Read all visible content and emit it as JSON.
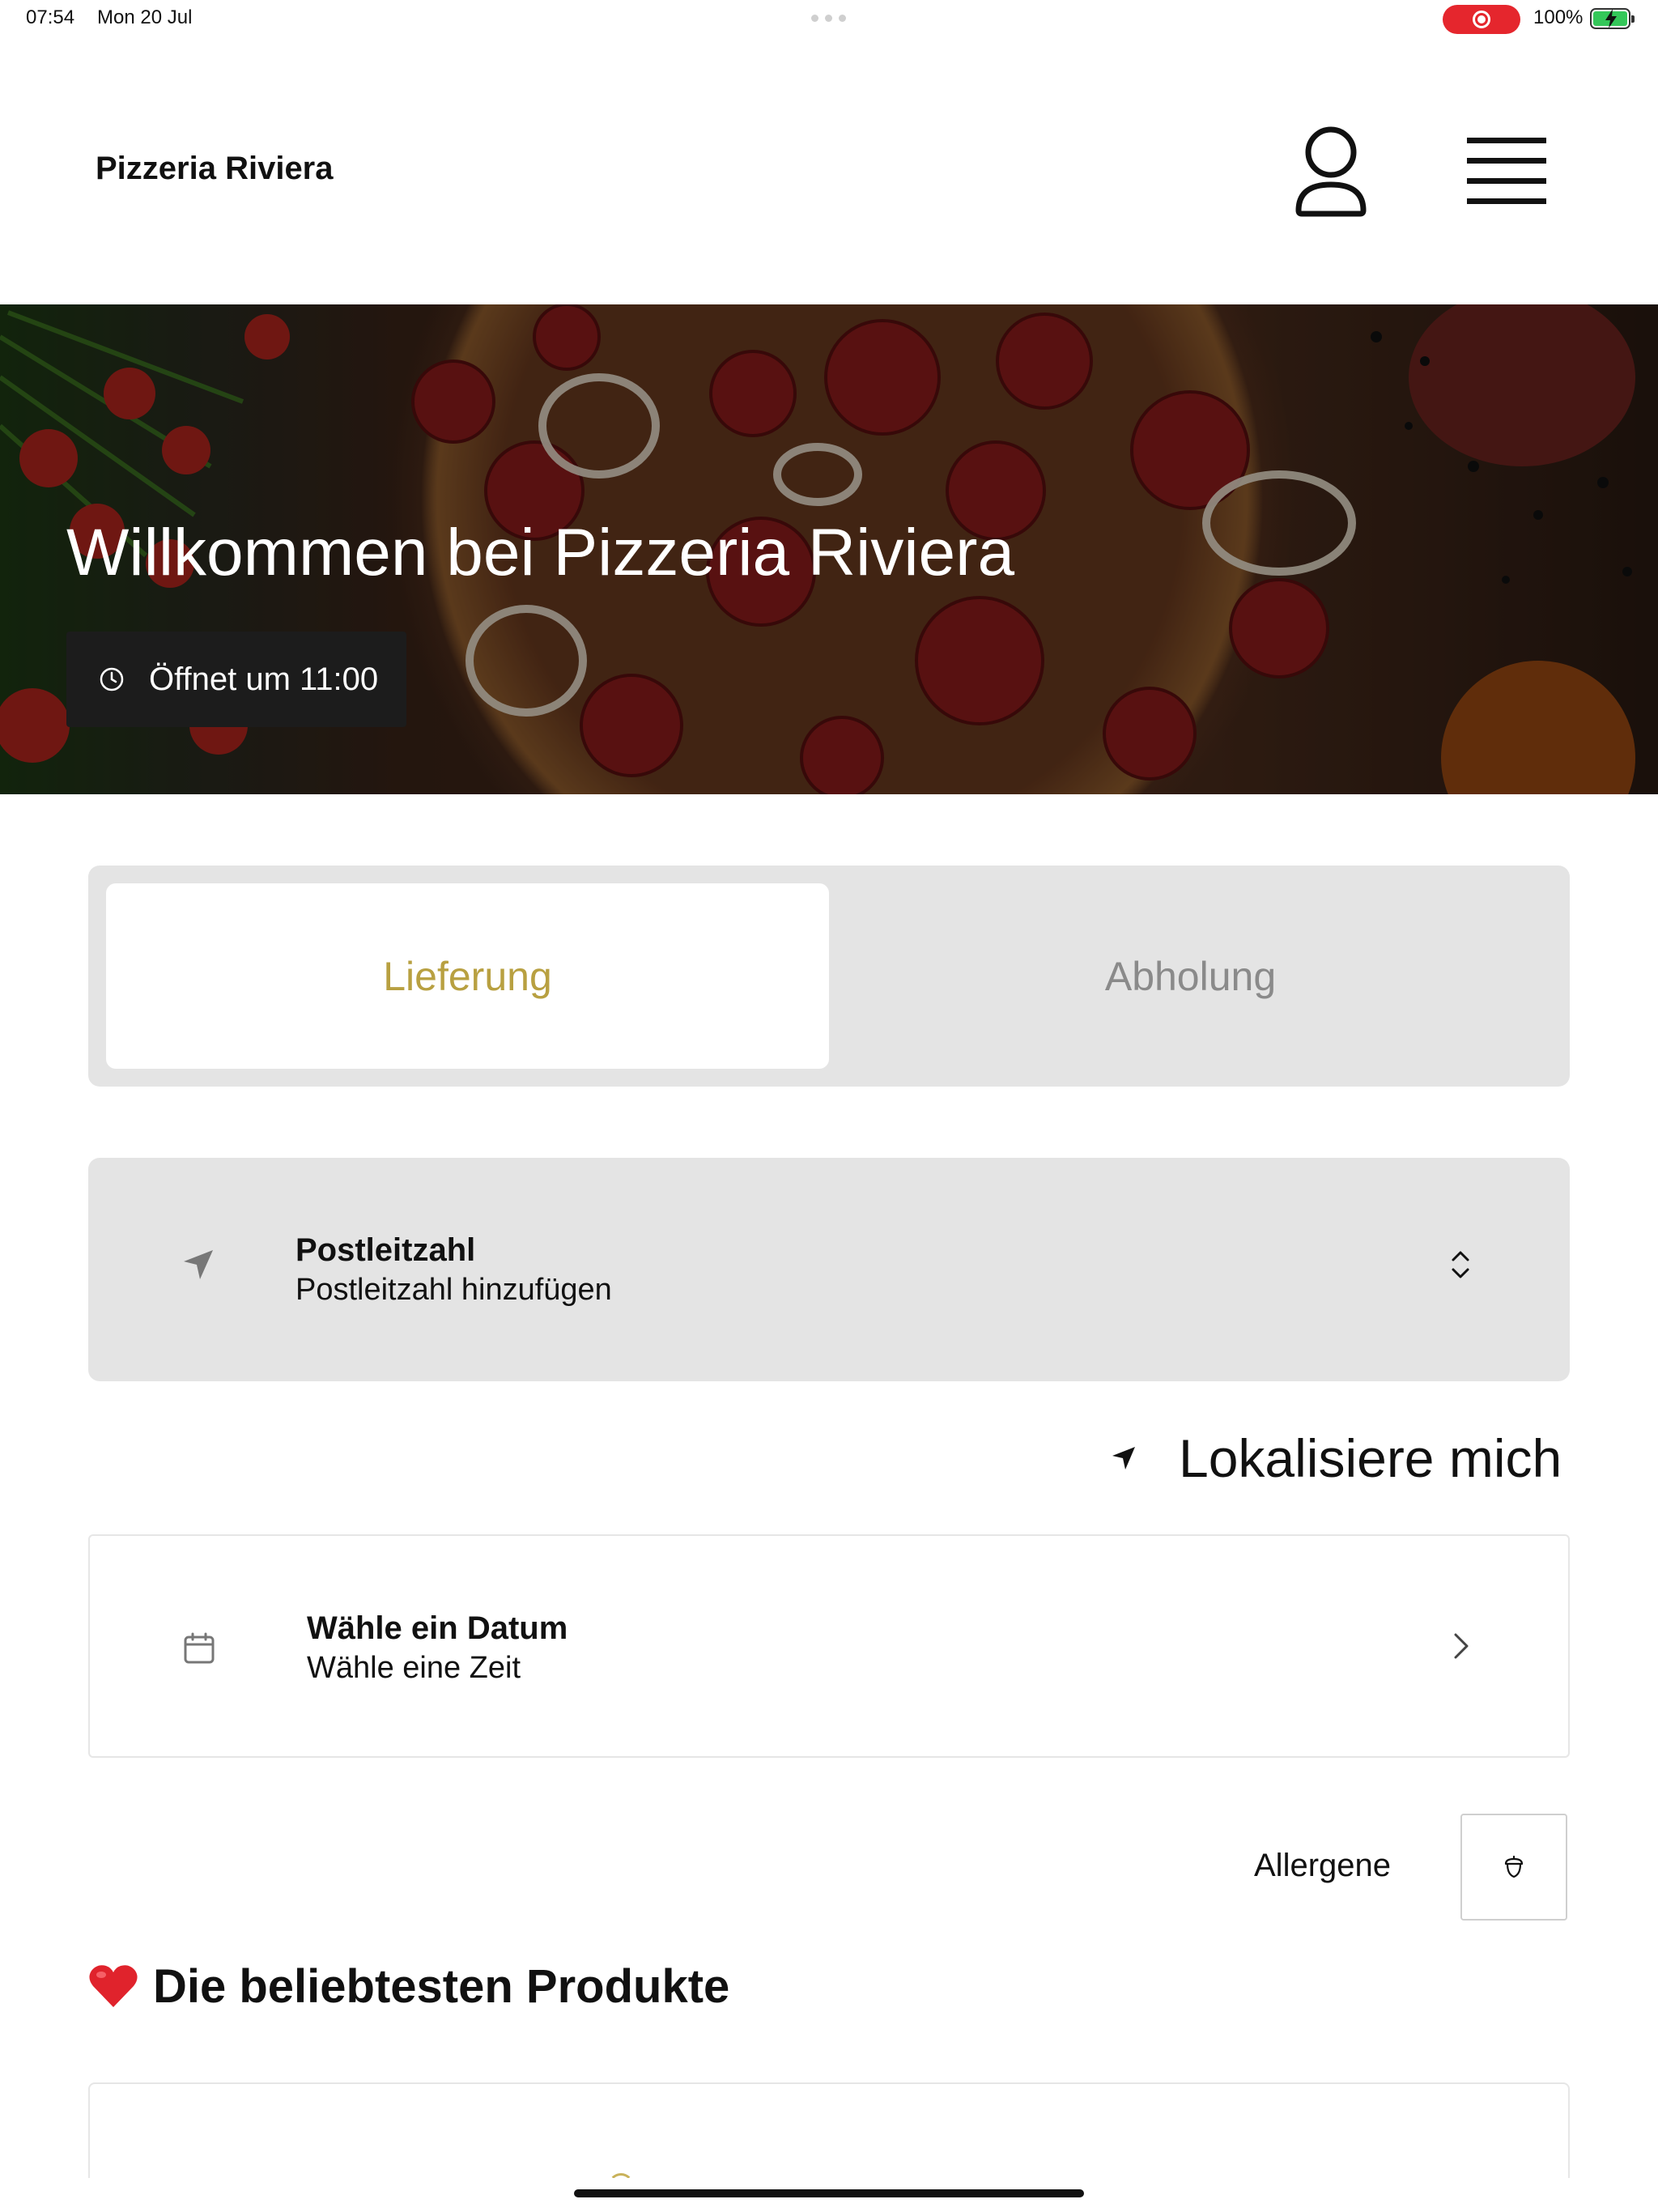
{
  "status_bar": {
    "time": "07:54",
    "date": "Mon 20 Jul",
    "battery": "100%",
    "record_color": "#e5262d"
  },
  "header": {
    "title": "Pizzeria Riviera",
    "profile_icon": "person-icon",
    "menu_icon": "hamburger-menu-icon"
  },
  "hero": {
    "title": "Willkommen bei Pizzeria Riviera",
    "hours": "Öffnet um 11:00",
    "hours_icon": "clock-icon"
  },
  "order_type": {
    "tabs": [
      {
        "label": "Lieferung",
        "active": true
      },
      {
        "label": "Abholung",
        "active": false
      }
    ],
    "accent_color": "#b8a041"
  },
  "postcode": {
    "label": "Postleitzahl",
    "value": "Postleitzahl hinzufügen",
    "icon": "location-arrow-icon"
  },
  "locate": {
    "label": "Lokalisiere mich",
    "icon": "location-arrow-icon"
  },
  "schedule": {
    "label": "Wähle ein Datum",
    "value": "Wähle eine Zeit",
    "icon": "calendar-icon"
  },
  "allergens": {
    "label": "Allergene",
    "icon": "acorn-icon"
  },
  "popular": {
    "title": "Die beliebtesten Produkte",
    "icon": "heart-icon"
  }
}
